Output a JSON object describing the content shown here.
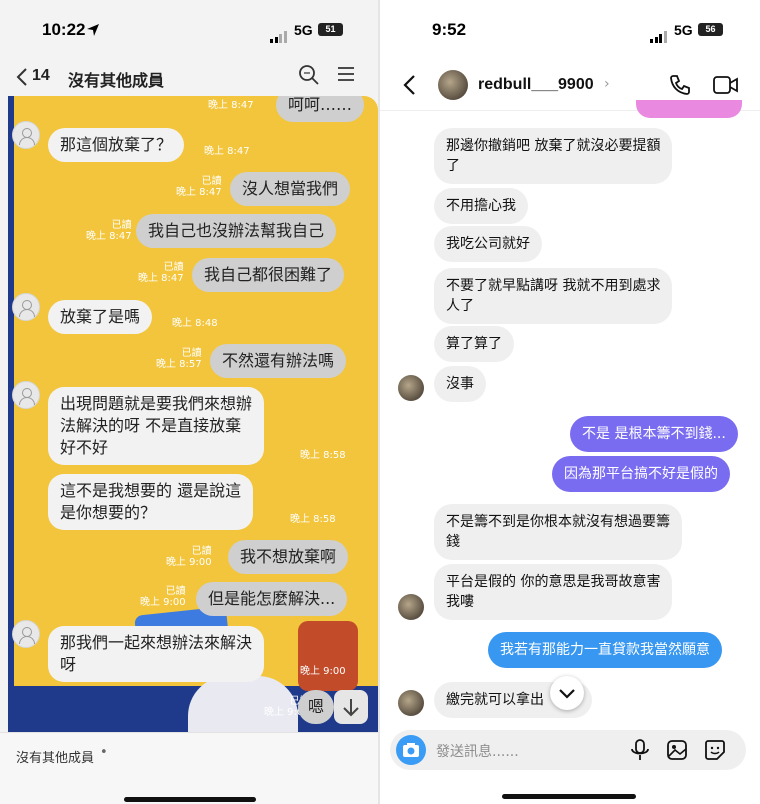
{
  "left": {
    "status": {
      "time": "10:22",
      "network": "5G",
      "battery": "51"
    },
    "header": {
      "back_count": "14",
      "title": "沒有其他成員"
    },
    "messages": [
      {
        "text": "呵呵……",
        "dir": "out",
        "read": "",
        "time": "晚上 8:47"
      },
      {
        "text": "那這個放棄了？",
        "dir": "in",
        "time": "晚上 8:47"
      },
      {
        "text": "沒人想當我們",
        "dir": "out",
        "read": "已讀",
        "time": "晚上 8:47"
      },
      {
        "text": "我自己也沒辦法幫我自己",
        "dir": "out",
        "read": "已讀",
        "time": "晚上 8:47"
      },
      {
        "text": "我自己都很困難了",
        "dir": "out",
        "read": "已讀",
        "time": "晚上 8:47"
      },
      {
        "text": "放棄了是嗎",
        "dir": "in",
        "time": "晚上 8:48"
      },
      {
        "text": "不然還有辦法嗎",
        "dir": "out",
        "read": "已讀",
        "time": "晚上 8:57"
      },
      {
        "lines": [
          "出現問題就是要我們來想辦",
          "法解決的呀  不是直接放棄",
          "好不好"
        ],
        "dir": "in",
        "time": "晚上 8:58"
      },
      {
        "lines": [
          "這不是我想要的  還是說這",
          "是你想要的？"
        ],
        "dir": "in",
        "time": "晚上 8:58"
      },
      {
        "text": "我不想放棄啊",
        "dir": "out",
        "read": "已讀",
        "time": "晚上 9:00"
      },
      {
        "text": "但是能怎麼解決...",
        "dir": "out",
        "read": "已讀",
        "time": "晚上 9:00"
      },
      {
        "lines": [
          "那我們一起來想辦法來解決",
          "呀"
        ],
        "dir": "in",
        "time": "晚上 9:00"
      },
      {
        "text": "嗯",
        "dir": "out",
        "read": "已讀",
        "time": "晚上 9:00"
      }
    ],
    "bottom_label": "沒有其他成員"
  },
  "right": {
    "status": {
      "time": "9:52",
      "network": "5G",
      "battery": "56"
    },
    "header": {
      "username": "redbull___9900"
    },
    "messages": [
      {
        "lines": [
          "那邊你撤銷吧  放棄了就沒必要提額",
          "了"
        ],
        "dir": "in"
      },
      {
        "text": "不用擔心我",
        "dir": "in"
      },
      {
        "text": "我吃公司就好",
        "dir": "in"
      },
      {
        "lines": [
          "不要了就早點講呀  我就不用到處求",
          "人了"
        ],
        "dir": "in"
      },
      {
        "text": "算了算了",
        "dir": "in"
      },
      {
        "text": "沒事",
        "dir": "in"
      },
      {
        "text": "不是 是根本籌不到錢...",
        "dir": "out"
      },
      {
        "text": "因為那平台搞不好是假的",
        "dir": "out"
      },
      {
        "lines": [
          "不是籌不到是你根本就沒有想過要籌",
          "錢"
        ],
        "dir": "in"
      },
      {
        "lines": [
          "平台是假的  你的意思是我哥故意害",
          "我嘍"
        ],
        "dir": "in"
      },
      {
        "text": "我若有那能力一直貸款我當然願意",
        "dir": "out"
      },
      {
        "text": "繳完就可以拿出",
        "tail": "呀",
        "dir": "in"
      }
    ],
    "input_placeholder": "發送訊息......"
  }
}
